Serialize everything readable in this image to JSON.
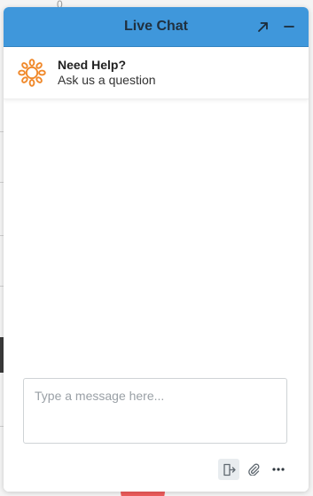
{
  "background": {
    "partial_digit": "0"
  },
  "chat": {
    "title": "Live Chat",
    "help": {
      "title": "Need Help?",
      "subtitle": "Ask us a question"
    },
    "composer": {
      "placeholder": "Type a message here..."
    },
    "colors": {
      "header": "#3f97db",
      "logo": "#f0892b"
    },
    "icons": {
      "expand": "arrow-up-right-icon",
      "minimize": "minus-icon",
      "logo": "sunburst-logo-icon",
      "end_chat": "exit-door-icon",
      "attach": "paperclip-icon",
      "more": "ellipsis-icon"
    }
  }
}
